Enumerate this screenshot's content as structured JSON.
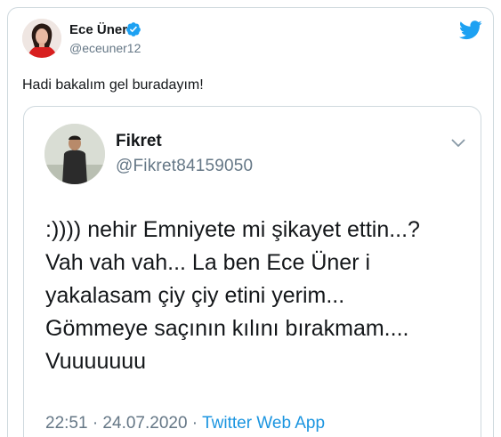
{
  "author": {
    "name": "Ece Üner",
    "handle": "@eceuner12"
  },
  "tweet": {
    "text": "Hadi bakalım gel buradayım!"
  },
  "quoted": {
    "name": "Fikret",
    "handle": "@Fikret84159050",
    "lines": [
      ":)))) nehir Emniyete mi şikayet ettin...?",
      "Vah vah vah... La ben Ece Üner i",
      "yakalasam çiy çiy etini yerim...",
      "Gömmeye saçının kılını bırakmam....",
      "Vuuuuuuu"
    ],
    "time": "22:51 · 24.07.2020 · ",
    "app": "Twitter Web App"
  },
  "icons": {
    "verified": "verified-badge-icon",
    "logo": "twitter-bird-icon",
    "menu": "chevron-down-icon"
  },
  "colors": {
    "brand": "#1da1f2",
    "link": "#1b95e0",
    "secondary_text": "#657786",
    "border": "#cfd9de"
  }
}
